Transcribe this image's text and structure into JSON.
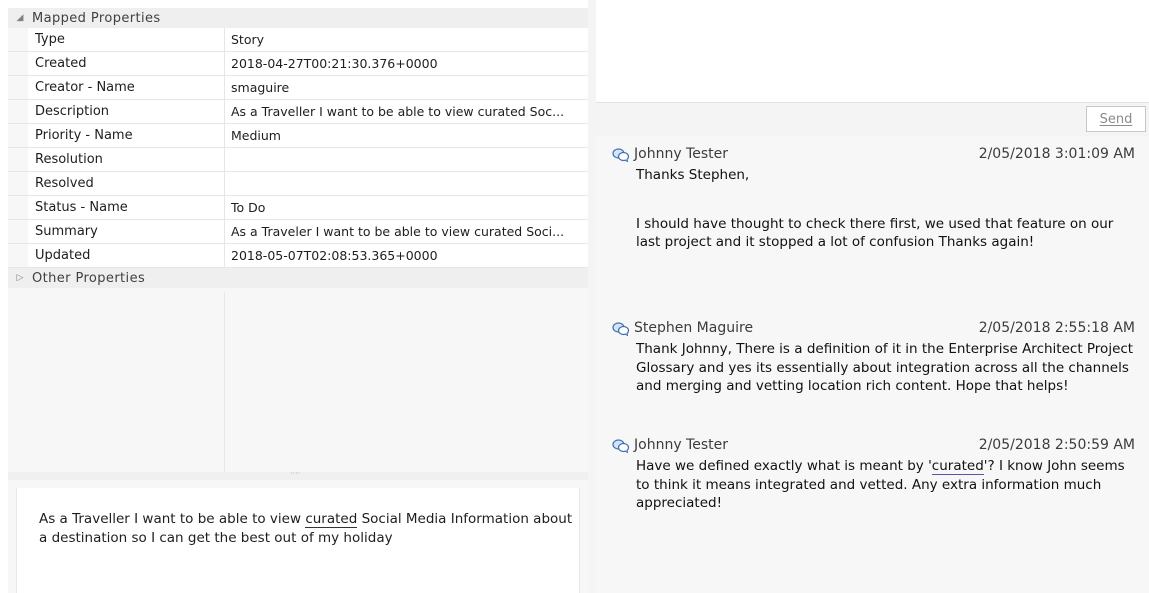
{
  "properties": {
    "mapped_group_label": "Mapped Properties",
    "other_group_label": "Other Properties",
    "rows": [
      {
        "name": "Type",
        "value": "Story"
      },
      {
        "name": "Created",
        "value": "2018-04-27T00:21:30.376+0000"
      },
      {
        "name": "Creator - Name",
        "value": "smaguire"
      },
      {
        "name": "Description",
        "value": "As a Traveller I want to be able to view curated Soc..."
      },
      {
        "name": "Priority - Name",
        "value": "Medium"
      },
      {
        "name": "Resolution",
        "value": ""
      },
      {
        "name": "Resolved",
        "value": ""
      },
      {
        "name": "Status - Name",
        "value": "To Do"
      },
      {
        "name": "Summary",
        "value": "As a Traveler I want to be able to view curated Soci..."
      },
      {
        "name": "Updated",
        "value": "2018-05-07T02:08:53.365+0000"
      }
    ]
  },
  "description_panel": {
    "before": "As a Traveller I want to be able to view ",
    "underlined": "curated",
    "after": " Social Media Information about a destination so I can get the best out of my holiday"
  },
  "discussion": {
    "send_label": "Send",
    "messages": [
      {
        "author": "Johnny Tester",
        "time": "2/05/2018 3:01:09 AM",
        "para1": "Thanks Stephen,",
        "para2": "I should have thought to check there first, we used that feature on our last project and it stopped a lot of confusion Thanks again!"
      },
      {
        "author": "Stephen Maguire",
        "time": "2/05/2018 2:55:18 AM",
        "para1": "Thank Johnny, There is a definition of it in the Enterprise Architect Project Glossary and yes its essentially about integration across all the channels and merging and vetting location rich content. Hope that helps!"
      },
      {
        "author": "Johnny Tester",
        "time": "2/05/2018 2:50:59 AM",
        "before": "Have we defined exactly what is meant by '",
        "underlined": "curated",
        "after": "'? I know John seems to think it means integrated and vetted. Any extra information much appreciated!"
      }
    ]
  },
  "colors": {
    "grid_bg": "#f7f7f7",
    "group_bg": "#efefef",
    "message_bg": "#f7f7f7",
    "icon_blue": "#3a6fb5"
  }
}
